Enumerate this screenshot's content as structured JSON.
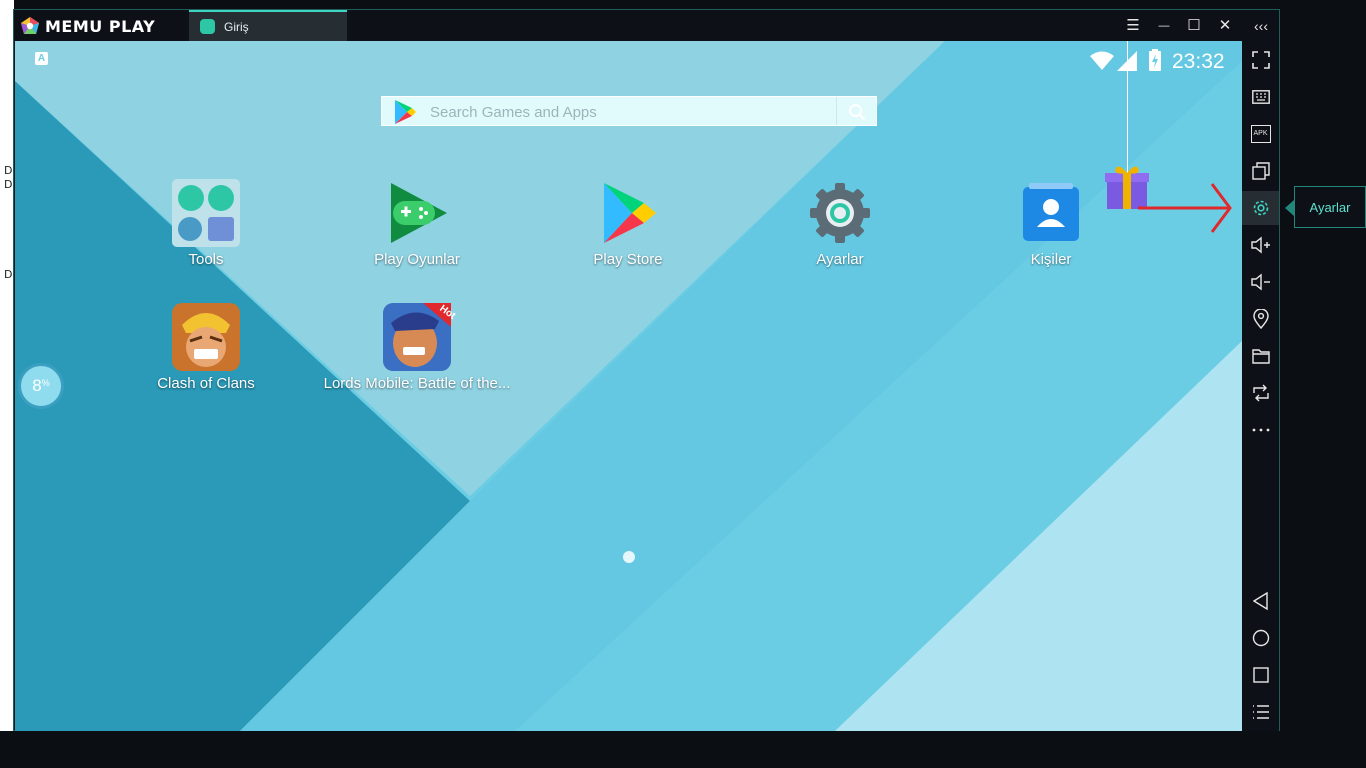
{
  "app": {
    "brand": "MEMU PLAY",
    "tab_label": "Giriş"
  },
  "desktop_fragments": [
    "D",
    "D",
    "D"
  ],
  "window_controls": {
    "menu": "☰",
    "minimize": "—",
    "maximize": "☐",
    "close": "✕",
    "collapse": "‹‹‹"
  },
  "android": {
    "time": "23:32",
    "keyboard_indicator": "A",
    "search_placeholder": "Search Games and Apps",
    "progress_percent": 8,
    "progress_label": "8",
    "progress_unit": "%",
    "apps": [
      {
        "label": "Tools",
        "icon": "tools-folder-icon"
      },
      {
        "label": "Play Oyunlar",
        "icon": "play-games-icon"
      },
      {
        "label": "Play Store",
        "icon": "play-store-icon"
      },
      {
        "label": "Ayarlar",
        "icon": "settings-icon"
      },
      {
        "label": "Kişiler",
        "icon": "contacts-icon"
      },
      {
        "label": "Clash of Clans",
        "icon": "clash-of-clans-icon"
      },
      {
        "label": "Lords Mobile: Battle of the...",
        "icon": "lords-mobile-icon"
      }
    ],
    "hot_badge": "Hot"
  },
  "sidebar": {
    "tools": [
      "fullscreen-icon",
      "keyboard-icon",
      "apk-icon",
      "multi-window-icon",
      "settings-icon",
      "volume-up-icon",
      "volume-down-icon",
      "location-icon",
      "folder-icon",
      "rotate-icon",
      "more-icon"
    ],
    "apk_label": "APK",
    "nav": [
      "back-icon",
      "home-icon",
      "recents-icon",
      "menu-list-icon"
    ],
    "tooltip": "Ayarlar"
  },
  "colors": {
    "accent": "#3fd6c3",
    "arrow": "#e0282d",
    "screen_bg": "#6bcde4"
  }
}
